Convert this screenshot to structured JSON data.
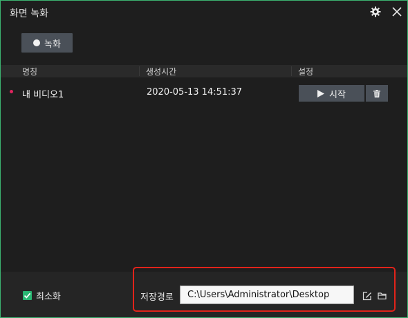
{
  "window": {
    "title": "화면 녹화"
  },
  "titlebar": {
    "settings_icon": "gear-icon",
    "close_icon": "close-icon"
  },
  "toolbar": {
    "record_label": "녹화"
  },
  "table": {
    "columns": [
      "명칭",
      "생성시간",
      "설정"
    ],
    "rows": [
      {
        "name": "내 비디오1",
        "created": "2020-05-13 14:51:37",
        "start_label": "시작",
        "status_color": "#e0245e"
      }
    ]
  },
  "footer": {
    "minimize_label": "최소화",
    "minimize_checked": true,
    "save_path_label": "저장경로",
    "save_path_value": "C:\\Users\\Administrator\\Desktop"
  },
  "colors": {
    "accent": "#2ab673",
    "highlight": "#e2231a",
    "button": "#4a5058"
  }
}
